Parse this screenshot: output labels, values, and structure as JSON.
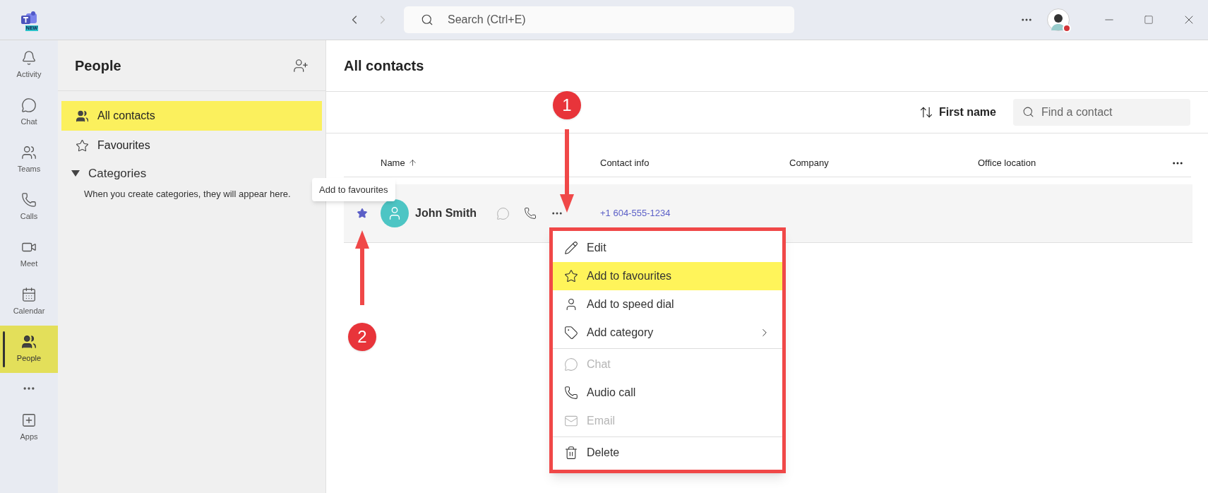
{
  "title_bar": {
    "search": {
      "placeholder": "Search (Ctrl+E)"
    },
    "logo_badge": "NEW",
    "presence_busy": true
  },
  "rail": [
    {
      "label": "Activity",
      "selected": false
    },
    {
      "label": "Chat",
      "selected": false
    },
    {
      "label": "Teams",
      "selected": false
    },
    {
      "label": "Calls",
      "selected": false
    },
    {
      "label": "Meet",
      "selected": false
    },
    {
      "label": "Calendar",
      "selected": false
    },
    {
      "label": "People",
      "selected": true
    },
    {
      "label": "Apps",
      "selected": false
    }
  ],
  "people_panel": {
    "title": "People",
    "nav": [
      {
        "label": "All contacts",
        "selected": true
      },
      {
        "label": "Favourites",
        "selected": false
      }
    ],
    "categories": {
      "label": "Categories",
      "expanded": true,
      "hint": "When you create categories, they will appear here."
    }
  },
  "tooltip": "Add to favourites",
  "main": {
    "title": "All contacts",
    "sort": {
      "label": "First name"
    },
    "find": {
      "placeholder": "Find a contact"
    },
    "columns": [
      "Name",
      "Contact info",
      "Company",
      "Office location"
    ],
    "contacts": [
      {
        "name": "John Smith",
        "phone": "+1 604-555-1234",
        "starred": true
      }
    ]
  },
  "context_menu": {
    "groups": [
      [
        {
          "label": "Edit",
          "highlighted": false,
          "disabled": false,
          "submenu": false
        },
        {
          "label": "Add to favourites",
          "highlighted": true,
          "disabled": false,
          "submenu": false
        },
        {
          "label": "Add to speed dial",
          "highlighted": false,
          "disabled": false,
          "submenu": false
        },
        {
          "label": "Add category",
          "highlighted": false,
          "disabled": false,
          "submenu": true
        }
      ],
      [
        {
          "label": "Chat",
          "highlighted": false,
          "disabled": true,
          "submenu": false
        },
        {
          "label": "Audio call",
          "highlighted": false,
          "disabled": false,
          "submenu": false
        },
        {
          "label": "Email",
          "highlighted": false,
          "disabled": true,
          "submenu": false
        }
      ],
      [
        {
          "label": "Delete",
          "highlighted": false,
          "disabled": false,
          "submenu": false
        }
      ]
    ]
  },
  "annotations": [
    {
      "label": "1"
    },
    {
      "label": "2"
    }
  ]
}
